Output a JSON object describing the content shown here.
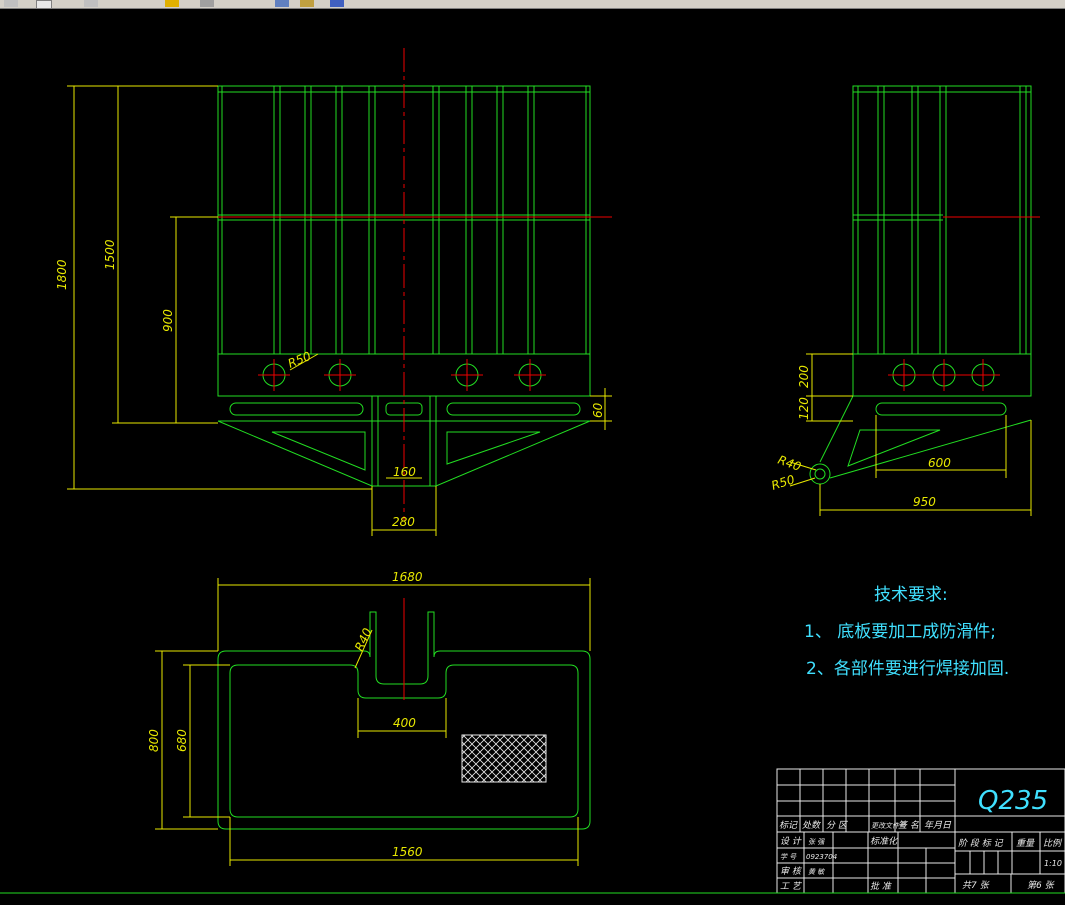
{
  "toolbar": {
    "buttons": [
      "pointer-icon",
      "zoom-icon",
      "pan-icon",
      "undo-icon",
      "properties-icon",
      "layer-icon",
      "help-icon"
    ]
  },
  "colors": {
    "background": "#000000",
    "outline": "#22dd22",
    "dimension": "#e8e800",
    "centerline": "#ee0000",
    "note": "#40e0ff",
    "titleblock": "#e8e8e8"
  },
  "dims": {
    "front": {
      "h1800": "1800",
      "h1500": "1500",
      "h900": "900",
      "r50": "R50",
      "d60": "60",
      "d160": "160",
      "d280": "280"
    },
    "side": {
      "h200": "200",
      "h120": "120",
      "r40": "R40",
      "r50": "R50",
      "d600": "600",
      "d950": "950"
    },
    "top": {
      "d1680": "1680",
      "r40": "R40",
      "d800": "800",
      "d680": "680",
      "d400": "400",
      "d1560": "1560"
    }
  },
  "notes": {
    "title": "技术要求:",
    "item1": "1、  底板要加工成防滑件;",
    "item2": "2、各部件要进行焊接加固."
  },
  "titleblock": {
    "material": "Q235",
    "row_mark": [
      "标记",
      "处数",
      "分 区",
      "更改文件号",
      "签 名",
      "年月日"
    ],
    "design": "设 计",
    "design_name": "张 强",
    "std": "标准化",
    "check": "审 核",
    "check_name": "黄 敏",
    "process": "工 艺",
    "approve": "批 准",
    "student_no_label": "学 号",
    "student_no": "0923704",
    "stage_cols": [
      "阶 段 标 记",
      "重量",
      "比例"
    ],
    "scale": "1:10",
    "total_sheets": "共7 张",
    "sheet_no": "第6 张"
  }
}
